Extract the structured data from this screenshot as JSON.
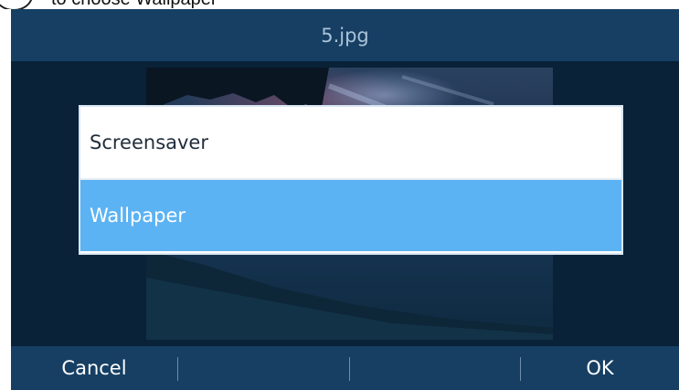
{
  "caption": {
    "text": "to choose Wallpaper"
  },
  "screen": {
    "title": "5.jpg",
    "options": [
      {
        "label": "Screensaver",
        "selected": false
      },
      {
        "label": "Wallpaper",
        "selected": true
      }
    ],
    "softkeys": {
      "left": "Cancel",
      "middle1": "",
      "middle2": "",
      "right": "OK"
    }
  },
  "colors": {
    "titlebar": "#163f63",
    "background": "#092238",
    "selection": "#5cb3f3",
    "title_text": "#a9c2d8"
  }
}
